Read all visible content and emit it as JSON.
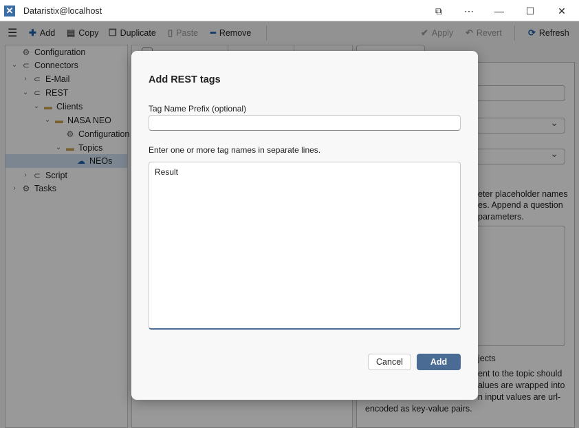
{
  "window": {
    "title": "Dataristix@localhost",
    "controls": [
      "cast",
      "more",
      "minimize",
      "maximize",
      "close"
    ]
  },
  "toolbar": {
    "add": "Add",
    "copy": "Copy",
    "duplicate": "Duplicate",
    "paste": "Paste",
    "remove": "Remove",
    "apply": "Apply",
    "revert": "Revert",
    "refresh": "Refresh"
  },
  "tree": {
    "items": [
      {
        "label": "Configuration",
        "icon": "gear-icon"
      },
      {
        "label": "Connectors",
        "icon": "plug-icon"
      },
      {
        "label": "E-Mail",
        "icon": "plug-icon"
      },
      {
        "label": "REST",
        "icon": "plug-icon"
      },
      {
        "label": "Clients",
        "icon": "folder-icon"
      },
      {
        "label": "NASA NEO",
        "icon": "folder-icon"
      },
      {
        "label": "Configuration",
        "icon": "gear-icon"
      },
      {
        "label": "Topics",
        "icon": "folder-icon"
      },
      {
        "label": "NEOs",
        "icon": "cloud-upload-icon",
        "selected": true
      },
      {
        "label": "Script",
        "icon": "plug-icon"
      },
      {
        "label": "Tasks",
        "icon": "gears-icon"
      }
    ]
  },
  "right_panel": {
    "lines": [
      "eter placeholder names",
      "es. Append a question",
      "parameters.",
      "jects",
      "ent to the topic should",
      "alues are wrapped into",
      "n input values are url-",
      "encoded as key-value pairs."
    ]
  },
  "dialog": {
    "title": "Add REST tags",
    "prefix_label": "Tag Name Prefix (optional)",
    "prefix_value": "",
    "names_label": "Enter one or more tag names in separate lines.",
    "names_value": "Result",
    "cancel": "Cancel",
    "add": "Add",
    "accent": "#4a6b94"
  }
}
